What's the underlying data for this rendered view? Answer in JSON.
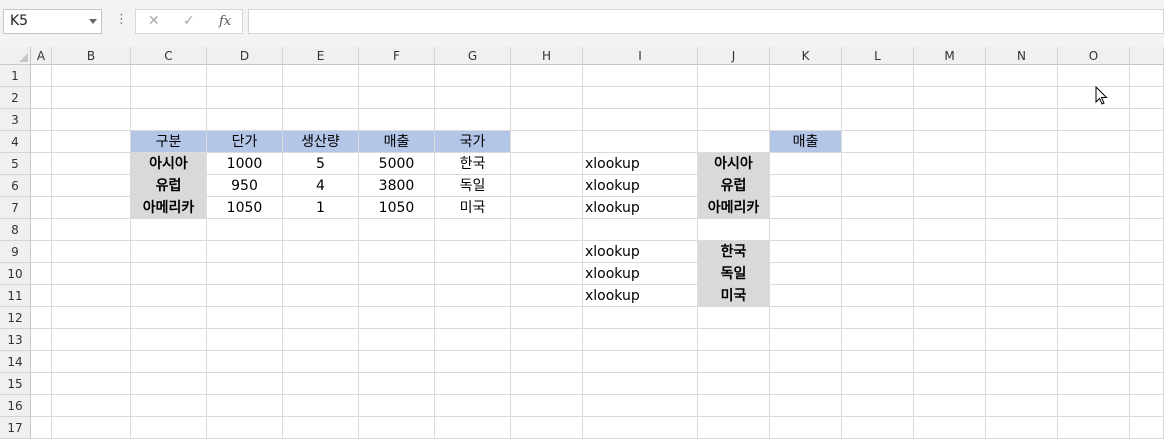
{
  "name_box": "K5",
  "formula": "",
  "columns": [
    "A",
    "B",
    "C",
    "D",
    "E",
    "F",
    "G",
    "H",
    "I",
    "J",
    "K",
    "L",
    "M",
    "N",
    "O"
  ],
  "rows": [
    "1",
    "2",
    "3",
    "4",
    "5",
    "6",
    "7",
    "8",
    "9",
    "10",
    "11",
    "12",
    "13",
    "14",
    "15",
    "16",
    "17"
  ],
  "table": {
    "headers": [
      "구분",
      "단가",
      "생산량",
      "매출",
      "국가"
    ],
    "rows": [
      [
        "아시아",
        "1000",
        "5",
        "5000",
        "한국"
      ],
      [
        "유럽",
        "950",
        "4",
        "3800",
        "독일"
      ],
      [
        "아메리카",
        "1050",
        "1",
        "1050",
        "미국"
      ]
    ]
  },
  "lookup_header": "매출",
  "lookup_regions": {
    "formula_labels": [
      "xlookup",
      "xlookup",
      "xlookup"
    ],
    "keys": [
      "아시아",
      "유럽",
      "아메리카"
    ]
  },
  "lookup_countries": {
    "formula_labels": [
      "xlookup",
      "xlookup",
      "xlookup"
    ],
    "keys": [
      "한국",
      "독일",
      "미국"
    ]
  },
  "colors": {
    "header_fill": "#b4c6e7",
    "key_fill": "#d9d9d9",
    "gridline": "#dadada"
  }
}
